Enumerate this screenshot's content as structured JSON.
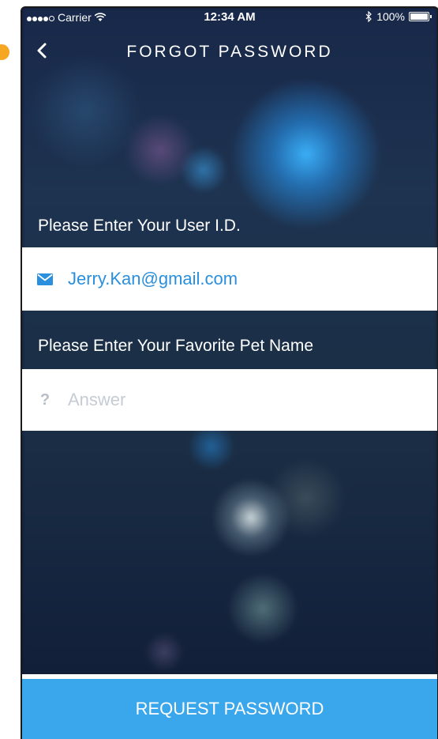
{
  "status_bar": {
    "carrier": "Carrier",
    "time": "12:34 AM",
    "battery": "100%"
  },
  "header": {
    "title": "FORGOT PASSWORD",
    "back_icon": "chevron-left-icon"
  },
  "form": {
    "user_id_label": "Please Enter Your User I.D.",
    "user_id_value": "Jerry.Kan@gmail.com",
    "user_id_icon": "envelope-icon",
    "pet_label": "Please Enter Your Favorite Pet Name",
    "pet_value": "",
    "pet_placeholder": "Answer",
    "pet_icon_glyph": "?"
  },
  "actions": {
    "request_label": "REQUEST PASSWORD"
  },
  "colors": {
    "accent": "#3aa6ec",
    "input_text": "#2a8fdc",
    "marker": "#f5a623"
  }
}
